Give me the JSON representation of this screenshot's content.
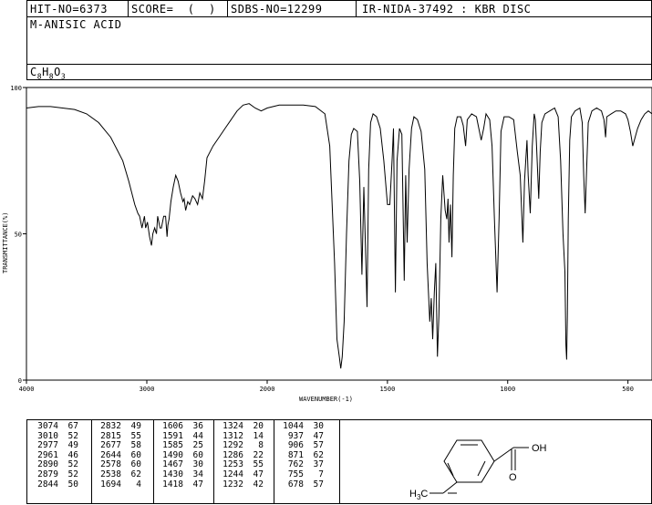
{
  "header": {
    "hit_no": "HIT-NO=6373",
    "score": "SCORE=  (  )",
    "sdbs_no": "SDBS-NO=12299",
    "ir_info": "IR-NIDA-37492 : KBR DISC",
    "compound_name": "M-ANISIC ACID",
    "formula": "C8H8O3"
  },
  "chart_data": {
    "type": "line",
    "title": "",
    "xlabel": "WAVENUMBER(-1)",
    "ylabel": "TRANSMITTANCE(%)",
    "xlim": [
      4000,
      400
    ],
    "ylim": [
      0,
      100
    ],
    "x_ticks": [
      "4000",
      "3000",
      "2000",
      "1500",
      "1000",
      "500"
    ],
    "y_ticks": [
      "100",
      "50",
      "0"
    ],
    "series": [
      {
        "name": "",
        "points": [
          [
            4000,
            93
          ],
          [
            3900,
            93.5
          ],
          [
            3800,
            93.5
          ],
          [
            3700,
            93
          ],
          [
            3600,
            92.5
          ],
          [
            3500,
            91
          ],
          [
            3400,
            88
          ],
          [
            3300,
            83
          ],
          [
            3200,
            75
          ],
          [
            3150,
            68
          ],
          [
            3100,
            60
          ],
          [
            3074,
            57
          ],
          [
            3060,
            56
          ],
          [
            3040,
            52
          ],
          [
            3020,
            56
          ],
          [
            3010,
            52
          ],
          [
            2995,
            54
          ],
          [
            2977,
            49
          ],
          [
            2961,
            46
          ],
          [
            2950,
            50
          ],
          [
            2935,
            52
          ],
          [
            2920,
            50
          ],
          [
            2910,
            56
          ],
          [
            2890,
            52
          ],
          [
            2879,
            52
          ],
          [
            2860,
            56
          ],
          [
            2844,
            56
          ],
          [
            2832,
            49
          ],
          [
            2825,
            53
          ],
          [
            2815,
            55
          ],
          [
            2800,
            61
          ],
          [
            2780,
            66
          ],
          [
            2760,
            70
          ],
          [
            2740,
            68
          ],
          [
            2720,
            64
          ],
          [
            2700,
            61
          ],
          [
            2690,
            62
          ],
          [
            2677,
            58
          ],
          [
            2660,
            61
          ],
          [
            2644,
            60
          ],
          [
            2620,
            63
          ],
          [
            2600,
            62
          ],
          [
            2578,
            60
          ],
          [
            2560,
            64
          ],
          [
            2538,
            62
          ],
          [
            2520,
            68
          ],
          [
            2500,
            76
          ],
          [
            2450,
            80
          ],
          [
            2400,
            83
          ],
          [
            2350,
            86
          ],
          [
            2300,
            89
          ],
          [
            2250,
            92
          ],
          [
            2200,
            94
          ],
          [
            2150,
            94.5
          ],
          [
            2100,
            93
          ],
          [
            2050,
            92
          ],
          [
            2000,
            93
          ],
          [
            1950,
            94
          ],
          [
            1900,
            94
          ],
          [
            1850,
            94
          ],
          [
            1800,
            93.5
          ],
          [
            1760,
            91
          ],
          [
            1740,
            80
          ],
          [
            1720,
            40
          ],
          [
            1710,
            14
          ],
          [
            1700,
            8
          ],
          [
            1694,
            4
          ],
          [
            1688,
            8
          ],
          [
            1680,
            20
          ],
          [
            1670,
            50
          ],
          [
            1660,
            75
          ],
          [
            1650,
            84
          ],
          [
            1640,
            86
          ],
          [
            1625,
            85
          ],
          [
            1615,
            68
          ],
          [
            1606,
            36
          ],
          [
            1598,
            66
          ],
          [
            1591,
            44
          ],
          [
            1585,
            25
          ],
          [
            1578,
            72
          ],
          [
            1570,
            88
          ],
          [
            1560,
            91
          ],
          [
            1545,
            90
          ],
          [
            1530,
            86
          ],
          [
            1515,
            75
          ],
          [
            1500,
            60
          ],
          [
            1490,
            60
          ],
          [
            1480,
            76
          ],
          [
            1475,
            86
          ],
          [
            1467,
            30
          ],
          [
            1460,
            75
          ],
          [
            1450,
            86
          ],
          [
            1440,
            84
          ],
          [
            1430,
            34
          ],
          [
            1424,
            70
          ],
          [
            1418,
            47
          ],
          [
            1410,
            72
          ],
          [
            1400,
            86
          ],
          [
            1390,
            90
          ],
          [
            1375,
            89
          ],
          [
            1360,
            85
          ],
          [
            1345,
            72
          ],
          [
            1335,
            40
          ],
          [
            1324,
            20
          ],
          [
            1318,
            28
          ],
          [
            1312,
            14
          ],
          [
            1305,
            30
          ],
          [
            1299,
            40
          ],
          [
            1292,
            8
          ],
          [
            1286,
            22
          ],
          [
            1278,
            55
          ],
          [
            1270,
            70
          ],
          [
            1260,
            58
          ],
          [
            1253,
            55
          ],
          [
            1248,
            62
          ],
          [
            1244,
            47
          ],
          [
            1238,
            60
          ],
          [
            1232,
            42
          ],
          [
            1226,
            70
          ],
          [
            1220,
            86
          ],
          [
            1210,
            90
          ],
          [
            1195,
            90
          ],
          [
            1185,
            87
          ],
          [
            1175,
            80
          ],
          [
            1168,
            89
          ],
          [
            1150,
            91
          ],
          [
            1130,
            90
          ],
          [
            1110,
            82
          ],
          [
            1100,
            86
          ],
          [
            1090,
            91
          ],
          [
            1075,
            89
          ],
          [
            1065,
            80
          ],
          [
            1055,
            55
          ],
          [
            1044,
            30
          ],
          [
            1036,
            55
          ],
          [
            1028,
            85
          ],
          [
            1015,
            90
          ],
          [
            995,
            90
          ],
          [
            975,
            89
          ],
          [
            960,
            78
          ],
          [
            948,
            70
          ],
          [
            937,
            47
          ],
          [
            930,
            68
          ],
          [
            920,
            82
          ],
          [
            915,
            70
          ],
          [
            906,
            57
          ],
          [
            898,
            80
          ],
          [
            890,
            91
          ],
          [
            885,
            89
          ],
          [
            880,
            80
          ],
          [
            871,
            62
          ],
          [
            865,
            78
          ],
          [
            858,
            88
          ],
          [
            845,
            91
          ],
          [
            825,
            92
          ],
          [
            805,
            93
          ],
          [
            790,
            90
          ],
          [
            780,
            75
          ],
          [
            770,
            50
          ],
          [
            762,
            37
          ],
          [
            758,
            12
          ],
          [
            755,
            7
          ],
          [
            752,
            22
          ],
          [
            748,
            55
          ],
          [
            742,
            82
          ],
          [
            735,
            90
          ],
          [
            720,
            92
          ],
          [
            700,
            93
          ],
          [
            690,
            88
          ],
          [
            684,
            70
          ],
          [
            678,
            57
          ],
          [
            672,
            72
          ],
          [
            665,
            88
          ],
          [
            650,
            92
          ],
          [
            630,
            93
          ],
          [
            610,
            92
          ],
          [
            600,
            89
          ],
          [
            593,
            83
          ],
          [
            588,
            90
          ],
          [
            570,
            91
          ],
          [
            550,
            92
          ],
          [
            530,
            92
          ],
          [
            510,
            91
          ],
          [
            500,
            89
          ],
          [
            490,
            85
          ],
          [
            480,
            80
          ],
          [
            470,
            83
          ],
          [
            460,
            86
          ],
          [
            445,
            89
          ],
          [
            430,
            91
          ],
          [
            415,
            92
          ],
          [
            400,
            91
          ]
        ]
      }
    ],
    "peak_table": [
      [
        "3074",
        "67"
      ],
      [
        "3010",
        "52"
      ],
      [
        "2977",
        "49"
      ],
      [
        "2961",
        "46"
      ],
      [
        "2890",
        "52"
      ],
      [
        "2879",
        "52"
      ],
      [
        "2844",
        "50"
      ],
      [
        "2832",
        "49"
      ],
      [
        "2815",
        "55"
      ],
      [
        "2677",
        "58"
      ],
      [
        "2644",
        "60"
      ],
      [
        "2578",
        "60"
      ],
      [
        "2538",
        "62"
      ],
      [
        "1694",
        "4"
      ],
      [
        "1606",
        "36"
      ],
      [
        "1591",
        "44"
      ],
      [
        "1585",
        "25"
      ],
      [
        "1490",
        "60"
      ],
      [
        "1467",
        "30"
      ],
      [
        "1430",
        "34"
      ],
      [
        "1418",
        "47"
      ],
      [
        "1324",
        "20"
      ],
      [
        "1312",
        "14"
      ],
      [
        "1292",
        "8"
      ],
      [
        "1286",
        "22"
      ],
      [
        "1253",
        "55"
      ],
      [
        "1244",
        "47"
      ],
      [
        "1232",
        "42"
      ],
      [
        "1044",
        "30"
      ],
      [
        "937",
        "47"
      ],
      [
        "906",
        "57"
      ],
      [
        "871",
        "62"
      ],
      [
        "762",
        "37"
      ],
      [
        "755",
        "7"
      ],
      [
        "678",
        "57"
      ]
    ]
  },
  "structure": {
    "label_oh": "OH",
    "label_o": "O",
    "label_h3c": "H3C"
  }
}
